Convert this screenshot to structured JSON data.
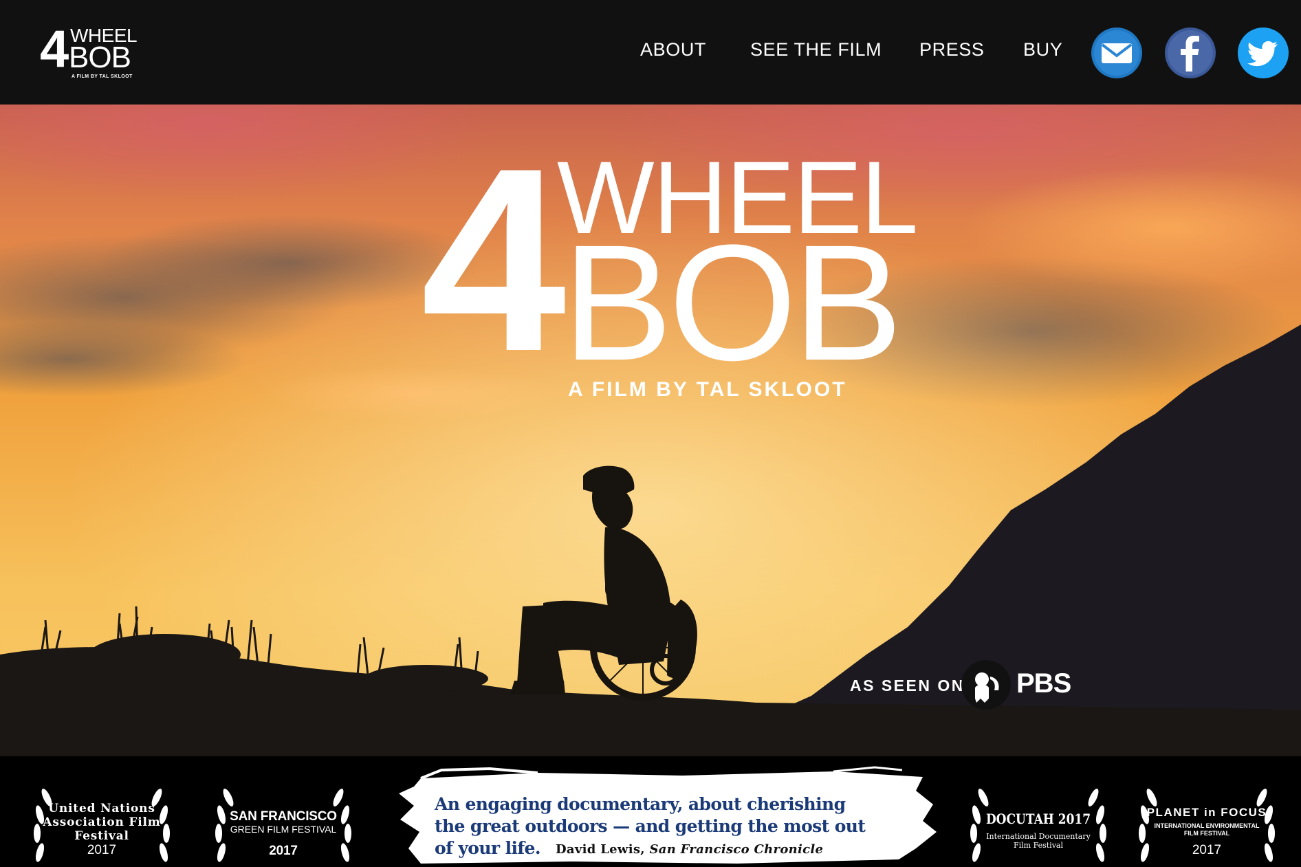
{
  "header": {
    "logo": {
      "number": "4",
      "word1": "WHEEL",
      "word2": "BOB",
      "subtitle": "A FILM BY TAL SKLOOT"
    },
    "nav": [
      {
        "label": "ABOUT"
      },
      {
        "label": "SEE THE FILM"
      },
      {
        "label": "PRESS"
      },
      {
        "label": "BUY"
      }
    ],
    "social": [
      {
        "icon": "mail-icon",
        "color": "#1f78c4"
      },
      {
        "icon": "facebook-icon",
        "color": "#3b5998"
      },
      {
        "icon": "twitter-icon",
        "color": "#1da1f2"
      }
    ]
  },
  "hero": {
    "title_number": "4",
    "title_line1": "WHEEL",
    "title_line2": "BOB",
    "tagline": "A FILM BY TAL SKLOOT",
    "seen_on": "AS SEEN ON",
    "network": "PBS"
  },
  "awards": {
    "laurels": [
      {
        "lines": [
          "United Nations",
          "Association Film",
          "Festival"
        ],
        "year": "2017"
      },
      {
        "title": "SAN FRANCISCO",
        "subtitle": "GREEN FILM FESTIVAL",
        "year": "2017"
      },
      {
        "title": "DOCUTAH 2017",
        "subtitle_lines": [
          "International Documentary",
          "Film Festival"
        ]
      },
      {
        "title": "PLANET in FOCUS",
        "subtitle_lines": [
          "INTERNATIONAL ENVIRONMENTAL",
          "FILM FESTIVAL"
        ],
        "year": "2017"
      }
    ],
    "quote": {
      "line1": "An engaging documentary, about cherishing",
      "line2": "the great outdoors — and getting the most out",
      "line3": "of your life.",
      "author": "David Lewis,",
      "source": "San Francisco Chronicle"
    }
  },
  "colors": {
    "header_bg": "#111111",
    "quote_text": "#1b3a78",
    "sky_top": "#c8624e",
    "sky_mid": "#f0a23e",
    "sky_low": "#f7c25c"
  }
}
